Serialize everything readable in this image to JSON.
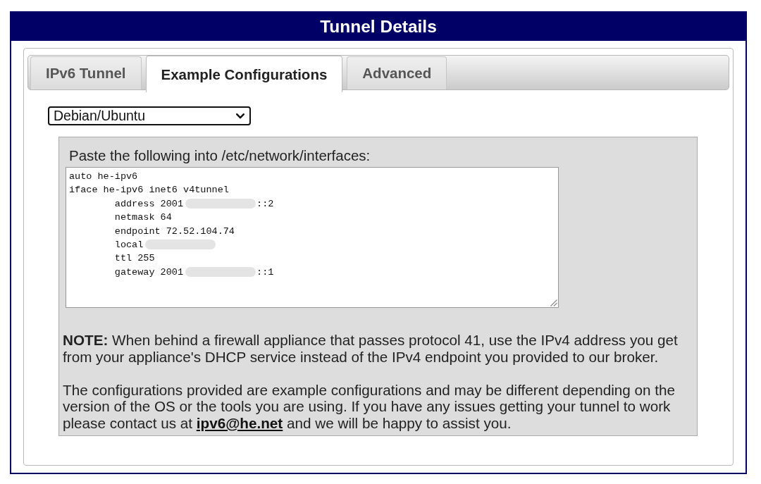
{
  "panel": {
    "title": "Tunnel Details"
  },
  "tabs": [
    {
      "label": "IPv6 Tunnel",
      "selected": false
    },
    {
      "label": "Example Configurations",
      "selected": true
    },
    {
      "label": "Advanced",
      "selected": false
    }
  ],
  "os_select": {
    "value": "Debian/Ubuntu"
  },
  "config": {
    "instruction": "Paste the following into /etc/network/interfaces:",
    "lines": [
      {
        "text": "auto he-ipv6",
        "redacted": false
      },
      {
        "text": "iface he-ipv6 inet6 v4tunnel",
        "redacted": false
      },
      {
        "text": "\taddress 2001",
        "redacted": true,
        "after": "::2"
      },
      {
        "text": "\tnetmask 64",
        "redacted": false
      },
      {
        "text": "\tendpoint 72.52.104.74",
        "redacted": false
      },
      {
        "text": "\tlocal",
        "redacted": true
      },
      {
        "text": "\tttl 255",
        "redacted": false
      },
      {
        "text": "\tgateway 2001",
        "redacted": true,
        "after": "::1"
      }
    ]
  },
  "notes": [
    {
      "text": "**NOTE:** When behind a firewall appliance that passes protocol 41, use the IPv4 address you get from your appliance's DHCP service instead of the IPv4 endpoint you provided to our broker."
    },
    {
      "text": "The configurations provided are example configurations and may be different depending on the version of the OS or the tools you are using. If you have any issues getting your tunnel to work please contact us at ",
      "link": "ipv6@he.net",
      "text_after": " and we will be happy to assist you."
    }
  ]
}
